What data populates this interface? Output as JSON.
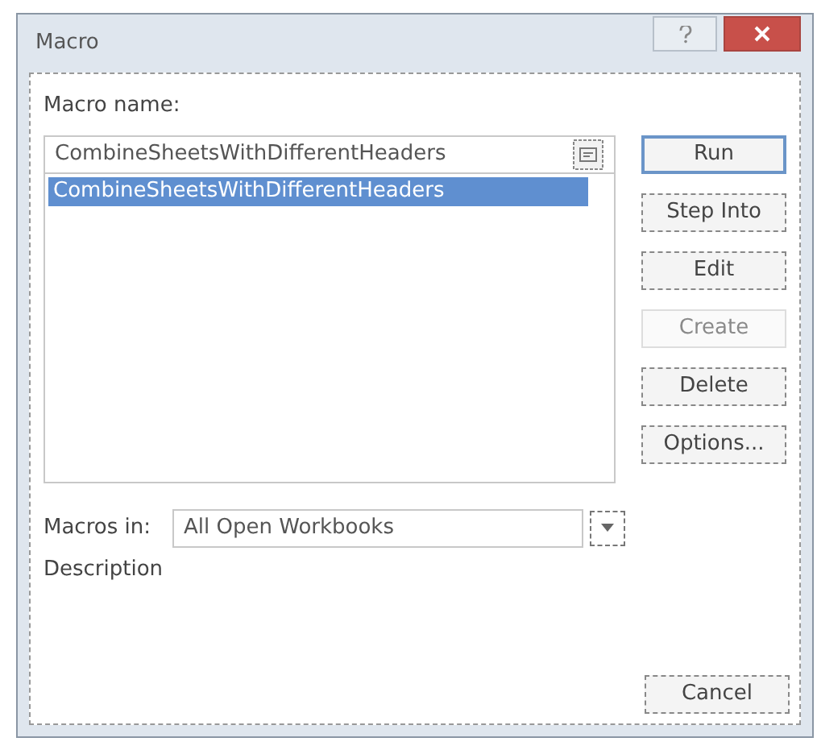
{
  "window": {
    "title": "Macro"
  },
  "macro_name": {
    "label": "Macro name:",
    "value": "CombineSheetsWithDifferentHeaders"
  },
  "macro_list": [
    {
      "label": "CombineSheetsWithDifferentHeaders",
      "selected": true
    }
  ],
  "buttons": [
    {
      "label": "Run",
      "default": true,
      "disabled": false
    },
    {
      "label": "Step Into",
      "default": false,
      "disabled": false
    },
    {
      "label": "Edit",
      "default": false,
      "disabled": false
    },
    {
      "label": "Create",
      "default": false,
      "disabled": true
    },
    {
      "label": "Delete",
      "default": false,
      "disabled": false
    },
    {
      "label": "Options...",
      "default": false,
      "disabled": false
    }
  ],
  "macros_in": {
    "label": "Macros in:",
    "value": "All Open Workbooks"
  },
  "description": {
    "label": "Description"
  },
  "cancel_button": {
    "label": "Cancel"
  }
}
